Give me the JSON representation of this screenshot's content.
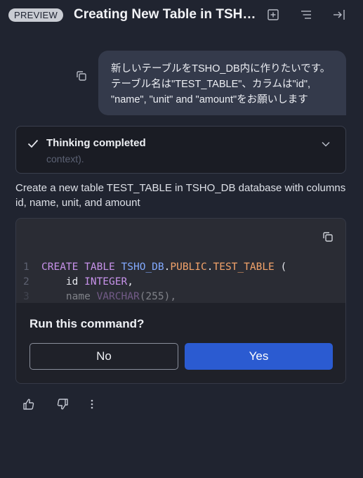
{
  "header": {
    "badge": "PREVIEW",
    "title": "Creating New Table in TSH…",
    "icons": [
      "add-square-icon",
      "list-icon",
      "collapse-right-icon"
    ]
  },
  "user_message": {
    "lines": [
      "新しいテーブルをTSHO_DB内に作りたいです。",
      "テーブル名は\"TEST_TABLE\"、カラムは\"id\",",
      "\"name\", \"unit\" and \"amount\"をお願いします"
    ]
  },
  "thinking": {
    "title": "Thinking completed",
    "subtitle": "context)."
  },
  "assistant": {
    "description": "Create a new table TEST_TABLE in TSHO_DB database with columns id, name, unit, and amount"
  },
  "code": {
    "line_numbers": [
      "1",
      "2",
      "3"
    ],
    "line1": {
      "kw1": "CREATE",
      "kw2": "TABLE",
      "db": "TSHO_DB",
      "dot1": ".",
      "schema": "PUBLIC",
      "dot2": ".",
      "table": "TEST_TABLE",
      "paren": " ("
    },
    "line2": {
      "col": "    id ",
      "type": "INTEGER",
      "comma": ","
    },
    "line3": {
      "col": "    name ",
      "type": "VARCHAR",
      "rest": "(255),"
    }
  },
  "confirm": {
    "question": "Run this command?",
    "no_label": "No",
    "yes_label": "Yes"
  },
  "colors": {
    "background": "#202430",
    "user_bubble": "#343a4b",
    "primary_button": "#2b5bd1",
    "keyword": "#c792ea",
    "identifier": "#82aaff",
    "table_name": "#f3a36a"
  }
}
